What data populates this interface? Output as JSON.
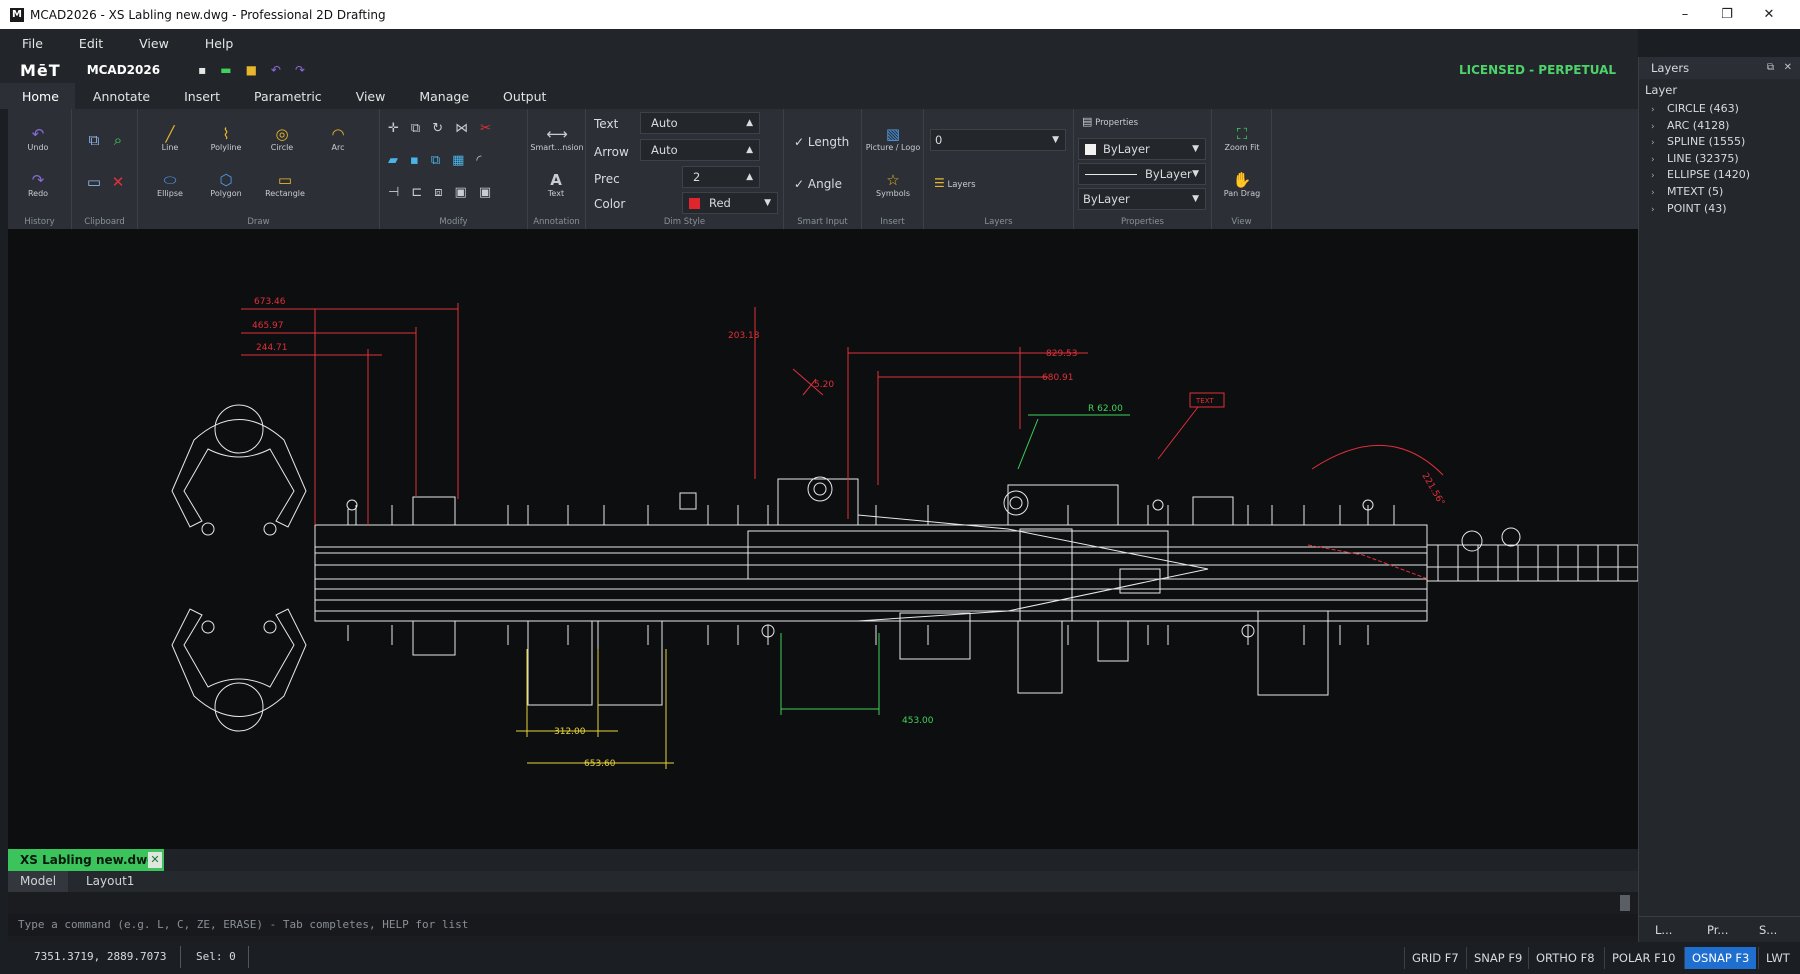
{
  "window": {
    "title": "MCAD2026 - XS Labling new.dwg - Professional 2D Drafting",
    "app_icon": "M",
    "minimize": "–",
    "maximize": "❐",
    "close": "✕"
  },
  "menu": [
    "File",
    "Edit",
    "View",
    "Help"
  ],
  "quick_access": {
    "logo": "MēT",
    "app_name": "MCAD2026",
    "license": "LICENSED - PERPETUAL",
    "icons": [
      "new-icon",
      "open-icon",
      "save-icon",
      "undo-icon",
      "redo-icon"
    ]
  },
  "ribbon_tabs": [
    "Home",
    "Annotate",
    "Insert",
    "Parametric",
    "View",
    "Manage",
    "Output"
  ],
  "ribbon": {
    "history": {
      "label": "History",
      "undo": "Undo",
      "redo": "Redo"
    },
    "clipboard": {
      "label": "Clipboard"
    },
    "draw": {
      "label": "Draw",
      "line": "Line",
      "polyline": "Polyline",
      "circle": "Circle",
      "arc": "Arc",
      "ellipse": "Ellipse",
      "polygon": "Polygon",
      "rectangle": "Rectangle"
    },
    "modify": {
      "label": "Modify"
    },
    "annotation": {
      "label": "Annotation",
      "smart_dimension": "Smart...nsion",
      "text": "Text"
    },
    "dim_style": {
      "label": "Dim Style",
      "text_label": "Text",
      "text_value": "Auto",
      "arrow_label": "Arrow",
      "arrow_value": "Auto",
      "prec_label": "Prec",
      "prec_value": "2",
      "color_label": "Color",
      "color_value": "Red",
      "color_swatch": "#e0252f"
    },
    "smart_input": {
      "label": "Smart Input",
      "length": "Length",
      "angle": "Angle"
    },
    "insert": {
      "label": "Insert",
      "picture_logo": "Picture / Logo",
      "symbols": "Symbols"
    },
    "layers": {
      "label": "Layers",
      "current_layer": "0",
      "layers_button": "Layers"
    },
    "properties": {
      "label": "Properties",
      "properties_button": "Properties",
      "color": "ByLayer",
      "linetype": "ByLayer",
      "lineweight": "ByLayer"
    },
    "view": {
      "label": "View",
      "zoom_fit": "Zoom Fit",
      "pan_drag": "Pan Drag"
    }
  },
  "drawing": {
    "dims_red": [
      "673.46",
      "465.97",
      "244.71",
      "203.18",
      "829.53",
      "680.91",
      "5.20",
      "221.56°"
    ],
    "radius_label": "R 62.00",
    "text_tag": "TEXT",
    "dims_yellow": [
      "312.00",
      "653.60"
    ],
    "dims_green": [
      "453.00"
    ],
    "colors": {
      "red": "#e0303a",
      "yellow": "#e6d43a",
      "green": "#3fd35a",
      "white": "#e8e8e8"
    }
  },
  "document_tab": {
    "name": "XS Labling new.dwg",
    "close": "✕"
  },
  "layout_tabs": [
    "Model",
    "Layout1"
  ],
  "command_line": {
    "placeholder": "Type a command  (e.g. L, C, ZE, ERASE)  -  Tab completes, HELP for list"
  },
  "status": {
    "coords": "7351.3719, 2889.7073",
    "selection": "Sel: 0",
    "toggles": [
      {
        "label": "GRID F7",
        "on": false
      },
      {
        "label": "SNAP F9",
        "on": false
      },
      {
        "label": "ORTHO F8",
        "on": false
      },
      {
        "label": "POLAR F10",
        "on": false
      },
      {
        "label": "OSNAP F3",
        "on": true
      },
      {
        "label": "LWT",
        "on": false
      }
    ]
  },
  "layers_panel": {
    "title": "Layers",
    "subheader": "Layer",
    "items": [
      "CIRCLE  (463)",
      "ARC  (4128)",
      "SPLINE  (1555)",
      "LINE  (32375)",
      "ELLIPSE  (1420)",
      "MTEXT  (5)",
      "POINT  (43)"
    ],
    "bottom_tabs": [
      "L...",
      "Pr...",
      "S..."
    ]
  }
}
